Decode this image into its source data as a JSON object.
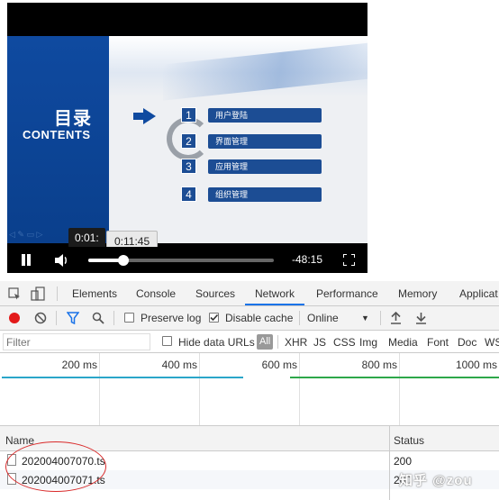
{
  "video": {
    "slide": {
      "title": "目录",
      "subtitle": "CONTENTS",
      "items": [
        {
          "num": "1",
          "label": "用户登陆"
        },
        {
          "num": "2",
          "label": "界面管理"
        },
        {
          "num": "3",
          "label": "应用管理"
        },
        {
          "num": "4",
          "label": "组织管理"
        }
      ]
    },
    "current_time": "0:01:",
    "preview_time": "0:11:45",
    "remaining": "-48:15",
    "progress_fraction": 0.19
  },
  "devtools": {
    "tabs": [
      "Elements",
      "Console",
      "Sources",
      "Network",
      "Performance",
      "Memory",
      "Applicat"
    ],
    "active_tab": "Network",
    "toolbar": {
      "preserve_log": "Preserve log",
      "disable_cache": "Disable cache",
      "throttle": "Online"
    },
    "filter": {
      "placeholder": "Filter",
      "hide_data_urls": "Hide data URLs",
      "all": "All",
      "types": [
        "XHR",
        "JS",
        "CSS",
        "Img",
        "Media",
        "Font",
        "Doc",
        "WS"
      ]
    },
    "timeline_ticks": [
      "200 ms",
      "400 ms",
      "600 ms",
      "800 ms",
      "1000 ms"
    ],
    "table": {
      "columns": {
        "name": "Name",
        "status": "Status"
      },
      "rows": [
        {
          "name": "202004007070.ts",
          "status": "200"
        },
        {
          "name": "202004007071.ts",
          "status": "200"
        }
      ]
    }
  },
  "watermark": "知乎 @zou",
  "colors": {
    "accent": "#1a73e8",
    "record": "#e31a1a",
    "slide_blue": "#0f4aa0"
  }
}
